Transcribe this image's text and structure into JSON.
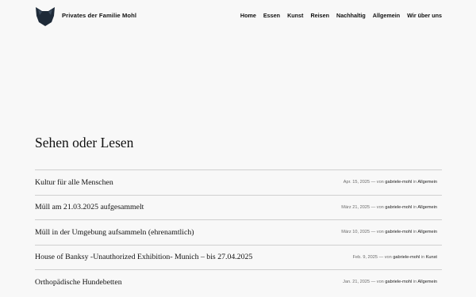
{
  "site": {
    "title": "Privates der Familie Mohl",
    "logo_icon": "fox-head-icon"
  },
  "nav": {
    "items": [
      {
        "label": "Home"
      },
      {
        "label": "Essen"
      },
      {
        "label": "Kunst"
      },
      {
        "label": "Reisen"
      },
      {
        "label": "Nachhaltig"
      },
      {
        "label": "Allgemein"
      },
      {
        "label": "Wir über uns"
      }
    ]
  },
  "page": {
    "title": "Sehen oder Lesen"
  },
  "posts": [
    {
      "title": "Kultur für alle Menschen",
      "date": "Apr. 15, 2025",
      "by": "— von",
      "author": "gabriele-mohl",
      "in": "in",
      "category": "Allgemein"
    },
    {
      "title": "Müll am 21.03.2025 aufgesammelt",
      "date": "März 21, 2025",
      "by": "— von",
      "author": "gabriele-mohl",
      "in": "in",
      "category": "Allgemein"
    },
    {
      "title": "Müll in der Umgebung aufsammeln (ehrenamtlich)",
      "date": "März 10, 2025",
      "by": "— von",
      "author": "gabriele-mohl",
      "in": "in",
      "category": "Allgemein"
    },
    {
      "title": "House of Banksy -Unauthorized Exhibition- Munich – bis 27.04.2025",
      "date": "Feb. 9, 2025",
      "by": "— von",
      "author": "gabriele-mohl",
      "in": "in",
      "category": "Kunst"
    },
    {
      "title": "Orthopädische Hundebetten",
      "date": "Jan. 21, 2025",
      "by": "— von",
      "author": "gabriele-mohl",
      "in": "in",
      "category": "Allgemein"
    }
  ],
  "colors": {
    "background": "#f8f8f8",
    "text": "#111111",
    "meta": "#6b6b6b",
    "divider": "#cfcfcf"
  }
}
